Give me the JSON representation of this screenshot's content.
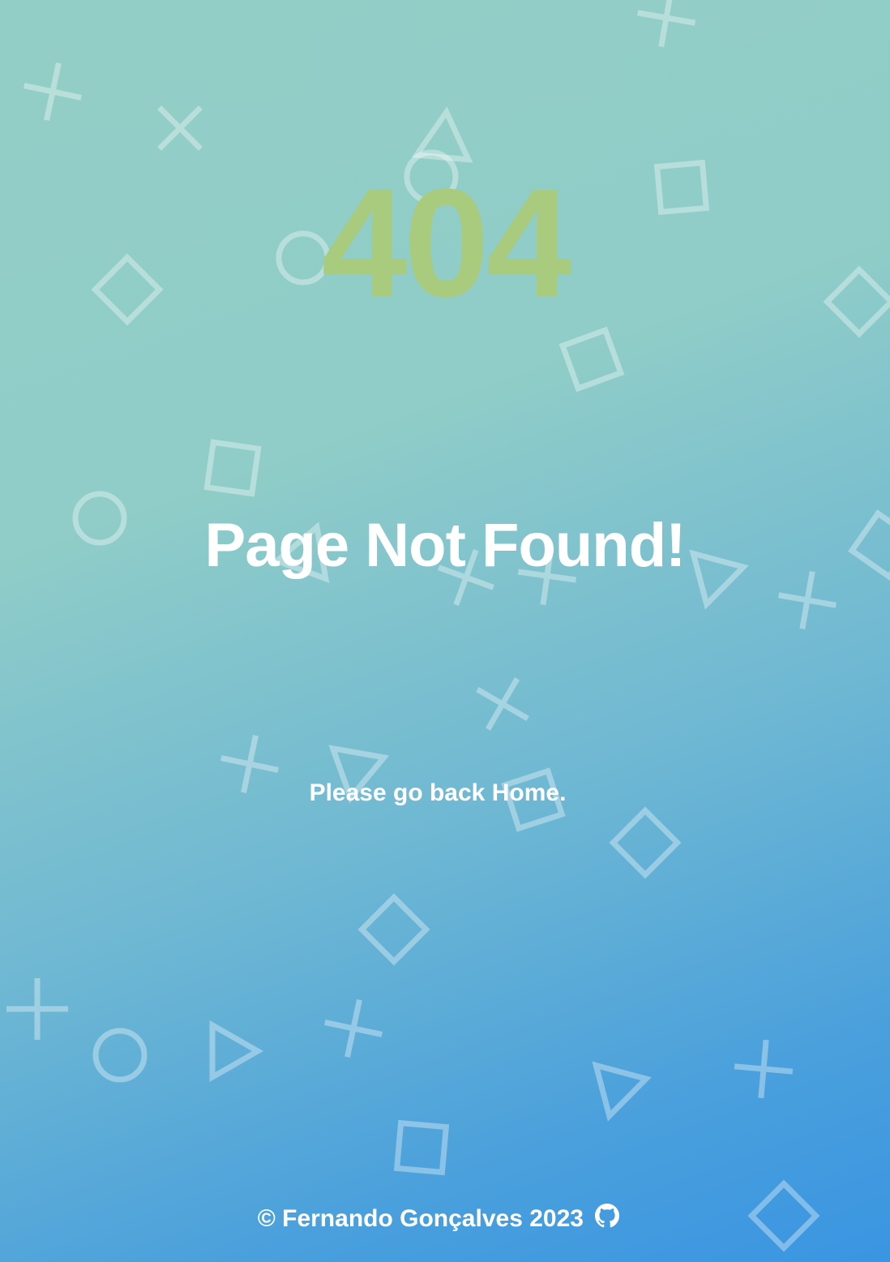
{
  "error": {
    "code": "404",
    "title": "Page Not Found!",
    "message_prefix": "Please go back ",
    "home_link": "Home",
    "message_suffix": "."
  },
  "footer": {
    "copyright": "© Fernando Gonçalves 2023",
    "github_icon": "github-icon"
  },
  "background": {
    "shape_icons": [
      "cross-icon",
      "circle-icon",
      "square-icon",
      "triangle-icon"
    ]
  },
  "colors": {
    "code": "#a9cb7e",
    "text": "#ffffff",
    "gradient_start": "#93cec6",
    "gradient_end": "#3a95e2"
  }
}
